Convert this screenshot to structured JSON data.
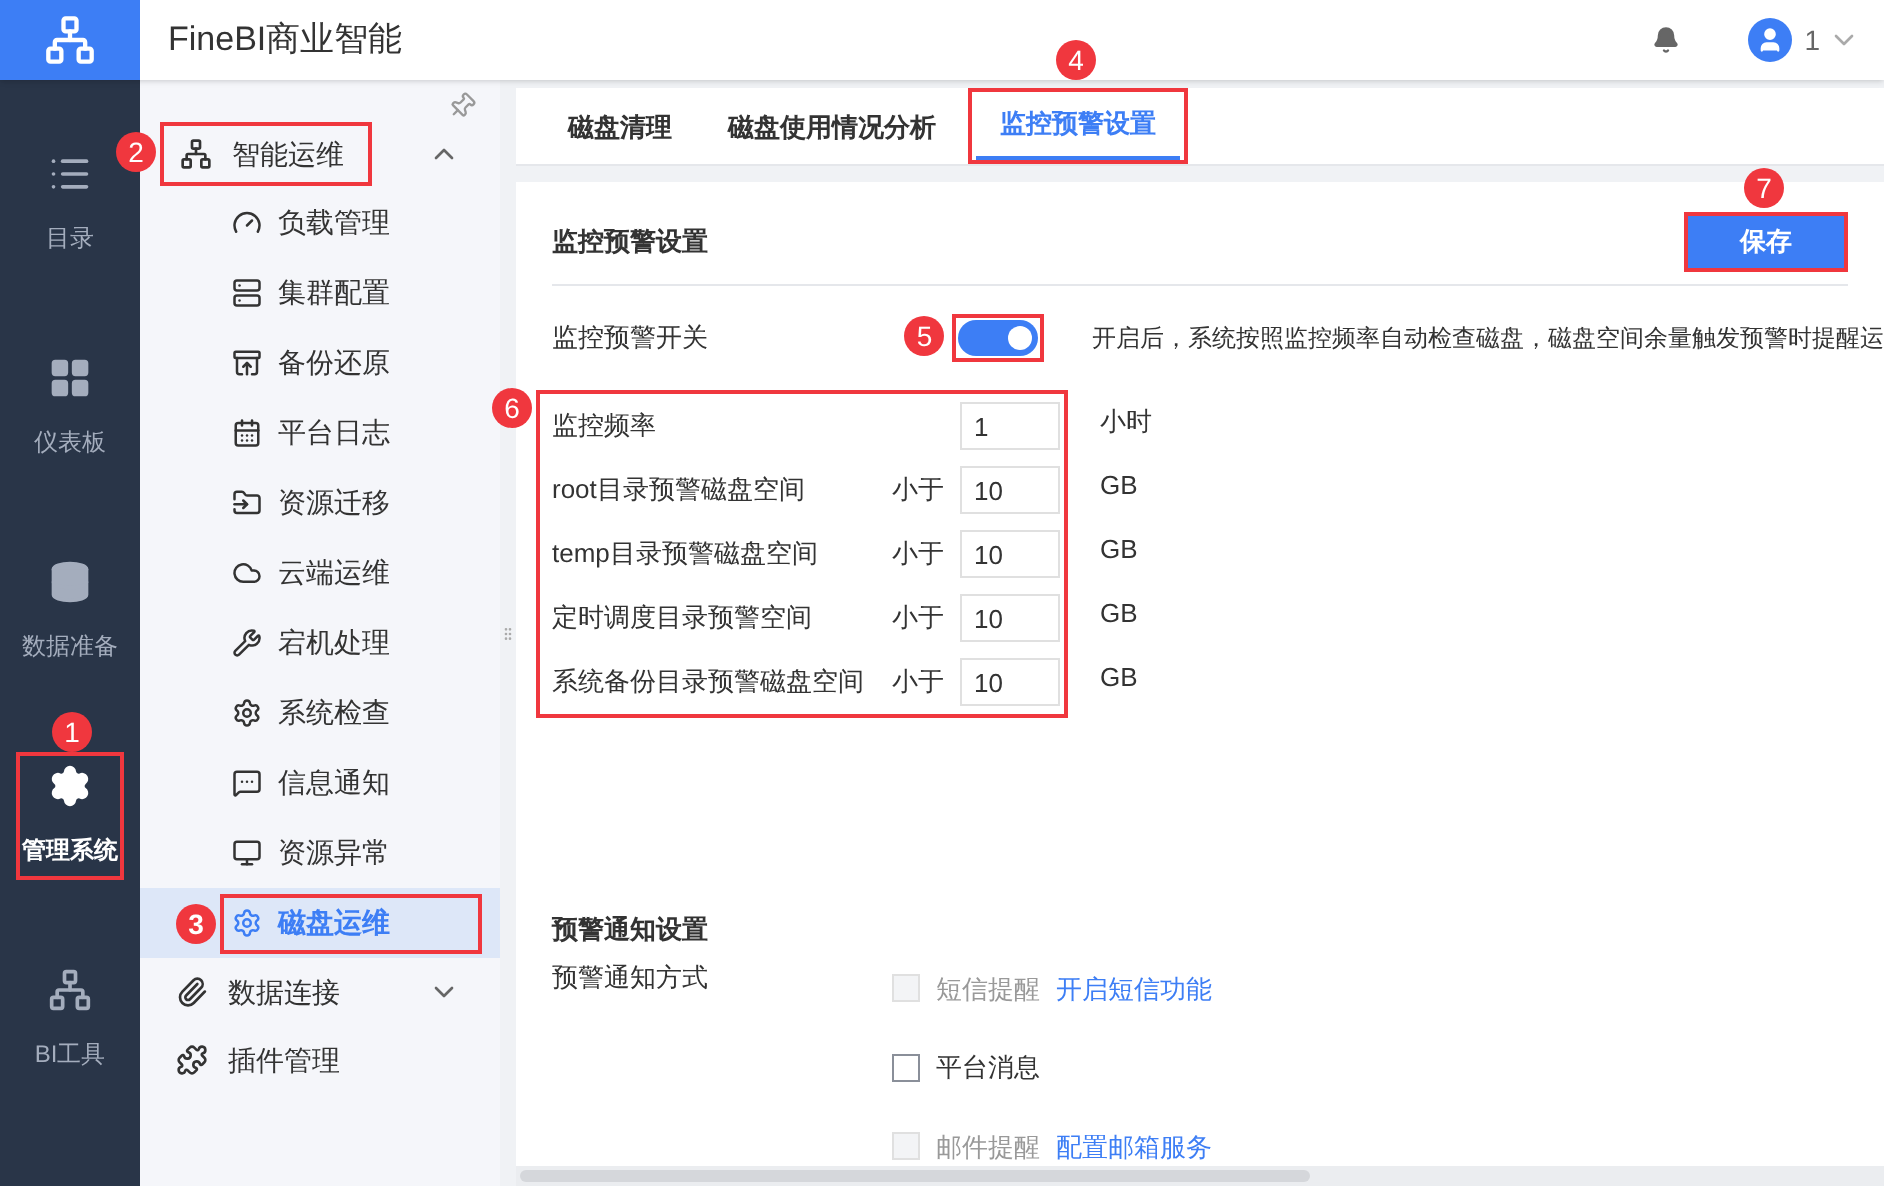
{
  "app": {
    "title": "FineBI商业智能",
    "user": "1"
  },
  "rail": [
    {
      "label": "目录",
      "selected": false
    },
    {
      "label": "仪表板",
      "selected": false
    },
    {
      "label": "数据准备",
      "selected": false
    },
    {
      "label": "管理系统",
      "selected": true,
      "callout": "1"
    },
    {
      "label": "BI工具",
      "selected": false
    }
  ],
  "menu": [
    {
      "label": "智能运维",
      "expanded": true,
      "callout": "2",
      "children": [
        {
          "label": "负载管理",
          "selected": false
        },
        {
          "label": "集群配置",
          "selected": false
        },
        {
          "label": "备份还原",
          "selected": false
        },
        {
          "label": "平台日志",
          "selected": false
        },
        {
          "label": "资源迁移",
          "selected": false
        },
        {
          "label": "云端运维",
          "selected": false
        },
        {
          "label": "宕机处理",
          "selected": false
        },
        {
          "label": "系统检查",
          "selected": false
        },
        {
          "label": "信息通知",
          "selected": false
        },
        {
          "label": "资源异常",
          "selected": false
        },
        {
          "label": "磁盘运维",
          "selected": true,
          "callout": "3"
        }
      ]
    },
    {
      "label": "数据连接",
      "expanded": false
    },
    {
      "label": "插件管理"
    }
  ],
  "tabs": [
    {
      "label": "磁盘清理",
      "selected": false
    },
    {
      "label": "磁盘使用情况分析",
      "selected": false
    },
    {
      "label": "监控预警设置",
      "selected": true,
      "callout": "4"
    }
  ],
  "monitor": {
    "title": "监控预警设置",
    "save": {
      "label": "保存",
      "callout": "7"
    },
    "switch": {
      "label": "监控预警开关",
      "on": true,
      "callout": "5",
      "description": "开启后，系统按照监控频率自动检查磁盘，磁盘空间余量触发预警时提醒运"
    },
    "fields_callout": "6",
    "fields": [
      {
        "label": "监控频率",
        "value": "1",
        "unit": "小时"
      },
      {
        "label": "root目录预警磁盘空间",
        "prefix": "小于",
        "value": "10",
        "unit": "GB"
      },
      {
        "label": "temp目录预警磁盘空间",
        "prefix": "小于",
        "value": "10",
        "unit": "GB"
      },
      {
        "label": "定时调度目录预警空间",
        "prefix": "小于",
        "value": "10",
        "unit": "GB"
      },
      {
        "label": "系统备份目录预警磁盘空间",
        "prefix": "小于",
        "value": "10",
        "unit": "GB"
      }
    ]
  },
  "notify": {
    "title": "预警通知设置",
    "label": "预警通知方式",
    "options": [
      {
        "label": "短信提醒",
        "checked": false,
        "disabled": true,
        "link": "开启短信功能"
      },
      {
        "label": "平台消息",
        "checked": false,
        "disabled": false
      },
      {
        "label": "邮件提醒",
        "checked": false,
        "disabled": true,
        "link": "配置邮箱服务"
      }
    ]
  }
}
